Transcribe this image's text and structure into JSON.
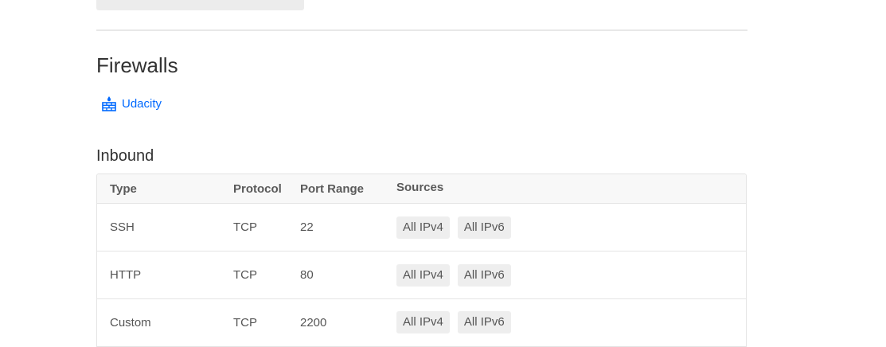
{
  "firewalls": {
    "title": "Firewalls",
    "items": [
      {
        "label": "Udacity",
        "icon": "firewall-icon"
      }
    ]
  },
  "inbound": {
    "title": "Inbound",
    "columns": [
      "Type",
      "Protocol",
      "Port Range",
      "Sources"
    ],
    "rules": [
      {
        "type": "SSH",
        "protocol": "TCP",
        "port_range": "22",
        "sources": [
          "All IPv4",
          "All IPv6"
        ]
      },
      {
        "type": "HTTP",
        "protocol": "TCP",
        "port_range": "80",
        "sources": [
          "All IPv4",
          "All IPv6"
        ]
      },
      {
        "type": "Custom",
        "protocol": "TCP",
        "port_range": "2200",
        "sources": [
          "All IPv4",
          "All IPv6"
        ]
      }
    ]
  },
  "colors": {
    "link": "#0069ff",
    "tag_background": "#eeeeee",
    "header_background": "#f8f8f8"
  }
}
